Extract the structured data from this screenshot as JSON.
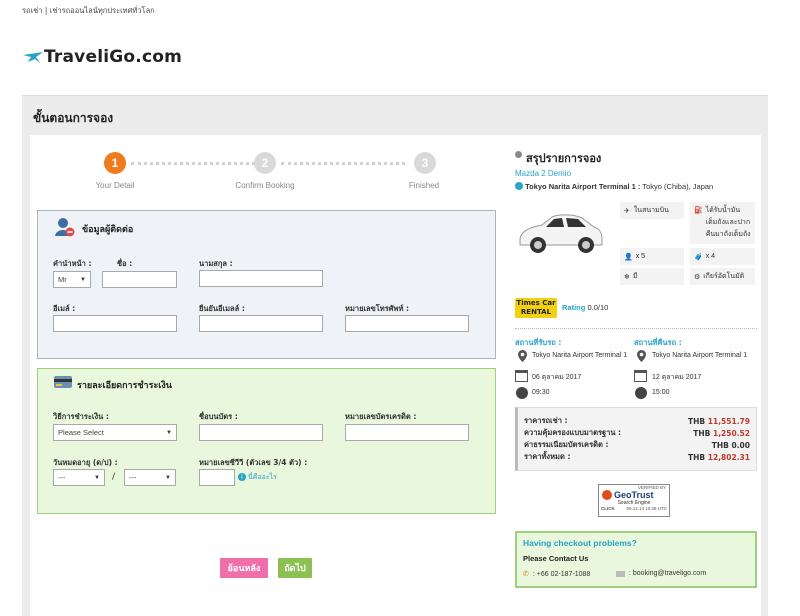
{
  "topbar": {
    "left": "รถเช่า",
    "sep": "|",
    "right": "เช่ารถออนไลน์ทุกประเทศทั่วโลก"
  },
  "logo": {
    "text": "TraveliGo.com"
  },
  "page_title": "ขั้นตอนการจอง",
  "steps": [
    {
      "num": "1",
      "label": "Your Detail",
      "active": true
    },
    {
      "num": "2",
      "label": "Confirm Booking",
      "active": false
    },
    {
      "num": "3",
      "label": "Finished",
      "active": false
    }
  ],
  "contact": {
    "title": "ข้อมูลผู้ติดต่อ",
    "prefix_label": "คำนำหน้า :",
    "prefix_value": "Mr",
    "firstname_label": "ชื่อ :",
    "lastname_label": "นามสกุล :",
    "email_label": "อีเมล์ :",
    "confirm_email_label": "ยืนยันอีเมลล์ :",
    "phone_label": "หมายเลขโทรศัพท์ :"
  },
  "payment": {
    "title": "รายละเอียดการชำระเงิน",
    "method_label": "วิธีการชำระเงิน :",
    "method_value": "Please Select",
    "cardname_label": "ชื่อบนบัตร :",
    "cardnum_label": "หมายเลขบัตรเครดิต :",
    "expiry_label": "วันหมดอายุ (ด/ป) :",
    "month_value": "---",
    "slash": "/",
    "year_value": "---",
    "cvv_label": "หมายเลขซีวีวี (ตัวเลข 3/4 ตัว) :",
    "cvv_help": "นี่คืออะไร"
  },
  "buttons": {
    "back": "ย้อนหลัง",
    "next": "ถัดไป"
  },
  "summary": {
    "title": "สรุปรายการจอง",
    "car": "Mazda 2 Demio",
    "location_bold": "Tokyo Narita Airport Terminal 1 :",
    "location_rest": "Tokyo (Chiba), Japan",
    "features": {
      "airport": "ในสนามบิน",
      "fuel": "ได้รับน้ำมันเต็มถังและปากคืนมาถังเต็มถัง",
      "seats": "x 5",
      "bags": "x 4",
      "ac": "มี",
      "transmission": "เกียร์อัตโนมัติ"
    },
    "supplier_line1": "Times Car",
    "supplier_line2": "RENTAL",
    "rating_label": "Rating",
    "rating_value": "0.0/10",
    "pickup_head": "สถานที่รับรถ :",
    "dropoff_head": "สถานที่คืนรถ :",
    "pickup_loc": "Tokyo Narita Airport Terminal 1",
    "dropoff_loc": "Tokyo Narita Airport Terminal 1",
    "pickup_date": "06 ตุลาคม 2017",
    "dropoff_date": "12 ตุลาคม 2017",
    "pickup_time": "09:30",
    "dropoff_time": "15:00",
    "prices": [
      {
        "label": "ราคารถเช่า :",
        "currency": "THB",
        "amount": "11,551.79",
        "red": true
      },
      {
        "label": "ความคุ้มครองแบบมาตรฐาน :",
        "currency": "THB",
        "amount": "1,250.52",
        "red": true
      },
      {
        "label": "ค่าธรรมเนียมบัตรเครดิต :",
        "currency": "THB",
        "amount": "0.00",
        "red": false
      },
      {
        "label": "ราคาทั้งหมด :",
        "currency": "THB",
        "amount": "12,802.31",
        "red": true
      }
    ],
    "trust": {
      "verified": "VERIFIED BY",
      "brand": "GeoTrust",
      "sub": "Search Engine",
      "click": "CLICK",
      "date": "09.12.13 10:28 UTC"
    },
    "help": {
      "title": "Having checkout problems?",
      "contact": "Please Contact Us",
      "phone": ": +66 02-187-1088",
      "email": ": booking@traveligo.com"
    }
  }
}
